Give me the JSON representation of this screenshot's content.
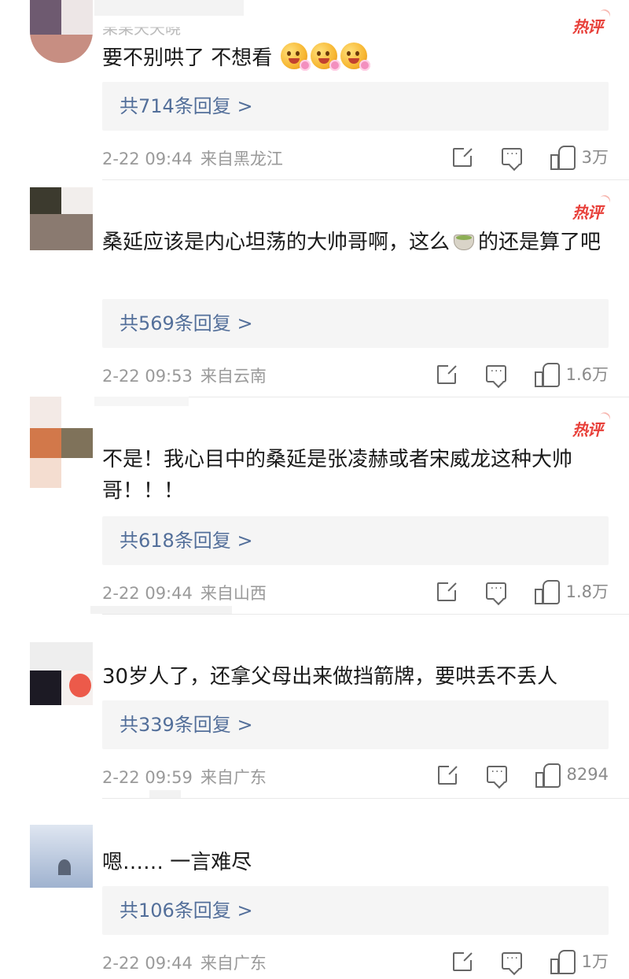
{
  "hot_label": "热评",
  "reply_suffix": "条回复 >",
  "reply_prefix": "共",
  "comments": [
    {
      "username": "果果天天晓",
      "text": "要不别哄了 不想看",
      "emoji_count": 3,
      "replies_count": "714",
      "time": "2-22 09:44",
      "location": "来自黑龙江",
      "likes": "3万",
      "hot": true
    },
    {
      "text": "桑延应该是内心坦荡的大帅哥啊，这么",
      "text_after_emoji": "的还是算了吧",
      "replies_count": "569",
      "time": "2-22 09:53",
      "location": "来自云南",
      "likes": "1.6万",
      "hot": true
    },
    {
      "text": "不是！我心目中的桑延是张凌赫或者宋威龙这种大帅哥！！！",
      "replies_count": "618",
      "time": "2-22 09:44",
      "location": "来自山西",
      "likes": "1.8万",
      "hot": true
    },
    {
      "text": "30岁人了，还拿父母出来做挡箭牌，要哄丢不丢人",
      "replies_count": "339",
      "time": "2-22 09:59",
      "location": "来自广东",
      "likes": "8294",
      "hot": false
    },
    {
      "text": "嗯…… 一言难尽",
      "replies_count": "106",
      "time": "2-22 09:44",
      "location": "来自广东",
      "likes": "1万",
      "hot": false
    }
  ],
  "icons": [
    "share-icon",
    "comment-icon",
    "like-icon",
    "emoji-flower-icon",
    "emoji-tea-icon",
    "hot-badge-icon"
  ],
  "colors": {
    "reply_link": "#536f9a",
    "hot": "#e8403a",
    "meta": "#9a9a9a",
    "reply_bg": "#f5f5f5"
  }
}
